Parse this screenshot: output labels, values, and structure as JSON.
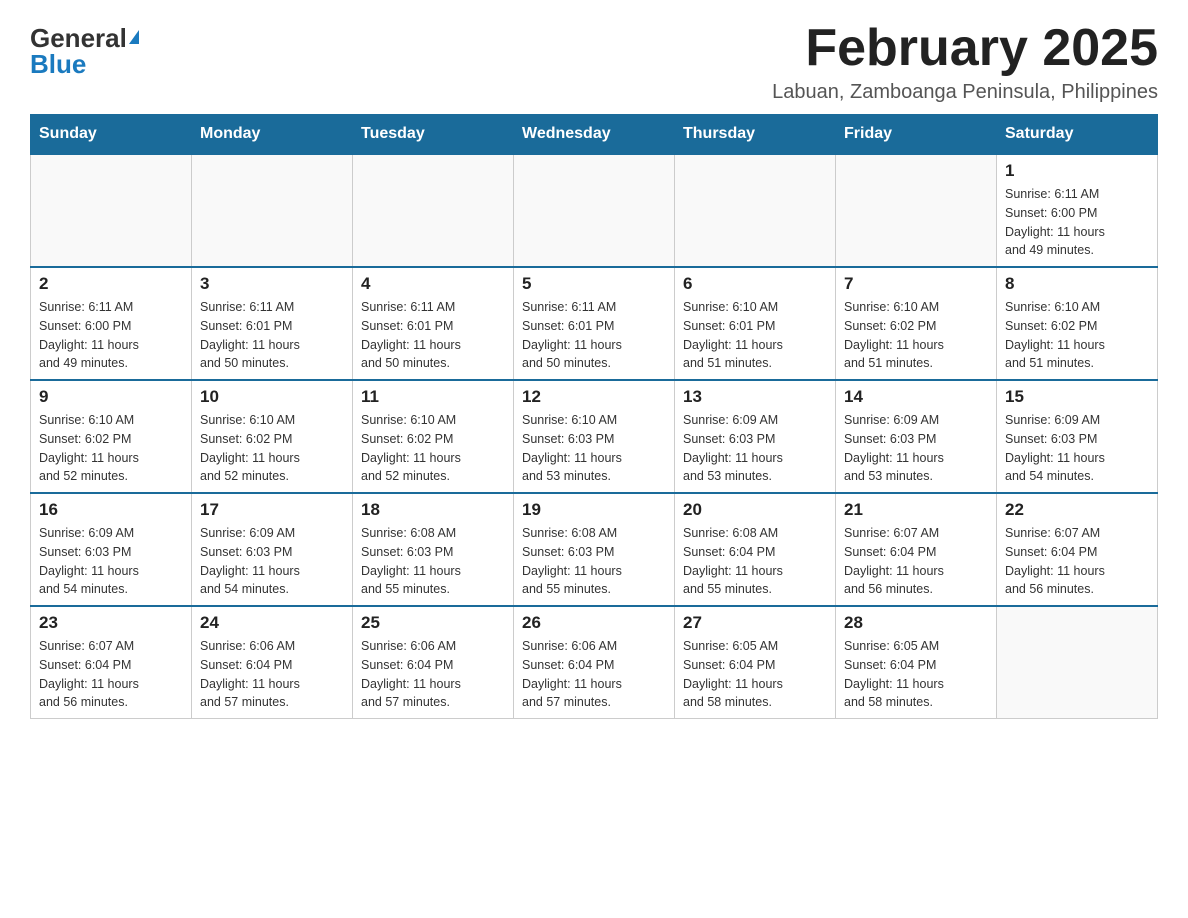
{
  "logo": {
    "general": "General",
    "blue": "Blue"
  },
  "title": {
    "month_year": "February 2025",
    "location": "Labuan, Zamboanga Peninsula, Philippines"
  },
  "weekdays": [
    "Sunday",
    "Monday",
    "Tuesday",
    "Wednesday",
    "Thursday",
    "Friday",
    "Saturday"
  ],
  "weeks": [
    [
      {
        "day": "",
        "info": ""
      },
      {
        "day": "",
        "info": ""
      },
      {
        "day": "",
        "info": ""
      },
      {
        "day": "",
        "info": ""
      },
      {
        "day": "",
        "info": ""
      },
      {
        "day": "",
        "info": ""
      },
      {
        "day": "1",
        "info": "Sunrise: 6:11 AM\nSunset: 6:00 PM\nDaylight: 11 hours\nand 49 minutes."
      }
    ],
    [
      {
        "day": "2",
        "info": "Sunrise: 6:11 AM\nSunset: 6:00 PM\nDaylight: 11 hours\nand 49 minutes."
      },
      {
        "day": "3",
        "info": "Sunrise: 6:11 AM\nSunset: 6:01 PM\nDaylight: 11 hours\nand 50 minutes."
      },
      {
        "day": "4",
        "info": "Sunrise: 6:11 AM\nSunset: 6:01 PM\nDaylight: 11 hours\nand 50 minutes."
      },
      {
        "day": "5",
        "info": "Sunrise: 6:11 AM\nSunset: 6:01 PM\nDaylight: 11 hours\nand 50 minutes."
      },
      {
        "day": "6",
        "info": "Sunrise: 6:10 AM\nSunset: 6:01 PM\nDaylight: 11 hours\nand 51 minutes."
      },
      {
        "day": "7",
        "info": "Sunrise: 6:10 AM\nSunset: 6:02 PM\nDaylight: 11 hours\nand 51 minutes."
      },
      {
        "day": "8",
        "info": "Sunrise: 6:10 AM\nSunset: 6:02 PM\nDaylight: 11 hours\nand 51 minutes."
      }
    ],
    [
      {
        "day": "9",
        "info": "Sunrise: 6:10 AM\nSunset: 6:02 PM\nDaylight: 11 hours\nand 52 minutes."
      },
      {
        "day": "10",
        "info": "Sunrise: 6:10 AM\nSunset: 6:02 PM\nDaylight: 11 hours\nand 52 minutes."
      },
      {
        "day": "11",
        "info": "Sunrise: 6:10 AM\nSunset: 6:02 PM\nDaylight: 11 hours\nand 52 minutes."
      },
      {
        "day": "12",
        "info": "Sunrise: 6:10 AM\nSunset: 6:03 PM\nDaylight: 11 hours\nand 53 minutes."
      },
      {
        "day": "13",
        "info": "Sunrise: 6:09 AM\nSunset: 6:03 PM\nDaylight: 11 hours\nand 53 minutes."
      },
      {
        "day": "14",
        "info": "Sunrise: 6:09 AM\nSunset: 6:03 PM\nDaylight: 11 hours\nand 53 minutes."
      },
      {
        "day": "15",
        "info": "Sunrise: 6:09 AM\nSunset: 6:03 PM\nDaylight: 11 hours\nand 54 minutes."
      }
    ],
    [
      {
        "day": "16",
        "info": "Sunrise: 6:09 AM\nSunset: 6:03 PM\nDaylight: 11 hours\nand 54 minutes."
      },
      {
        "day": "17",
        "info": "Sunrise: 6:09 AM\nSunset: 6:03 PM\nDaylight: 11 hours\nand 54 minutes."
      },
      {
        "day": "18",
        "info": "Sunrise: 6:08 AM\nSunset: 6:03 PM\nDaylight: 11 hours\nand 55 minutes."
      },
      {
        "day": "19",
        "info": "Sunrise: 6:08 AM\nSunset: 6:03 PM\nDaylight: 11 hours\nand 55 minutes."
      },
      {
        "day": "20",
        "info": "Sunrise: 6:08 AM\nSunset: 6:04 PM\nDaylight: 11 hours\nand 55 minutes."
      },
      {
        "day": "21",
        "info": "Sunrise: 6:07 AM\nSunset: 6:04 PM\nDaylight: 11 hours\nand 56 minutes."
      },
      {
        "day": "22",
        "info": "Sunrise: 6:07 AM\nSunset: 6:04 PM\nDaylight: 11 hours\nand 56 minutes."
      }
    ],
    [
      {
        "day": "23",
        "info": "Sunrise: 6:07 AM\nSunset: 6:04 PM\nDaylight: 11 hours\nand 56 minutes."
      },
      {
        "day": "24",
        "info": "Sunrise: 6:06 AM\nSunset: 6:04 PM\nDaylight: 11 hours\nand 57 minutes."
      },
      {
        "day": "25",
        "info": "Sunrise: 6:06 AM\nSunset: 6:04 PM\nDaylight: 11 hours\nand 57 minutes."
      },
      {
        "day": "26",
        "info": "Sunrise: 6:06 AM\nSunset: 6:04 PM\nDaylight: 11 hours\nand 57 minutes."
      },
      {
        "day": "27",
        "info": "Sunrise: 6:05 AM\nSunset: 6:04 PM\nDaylight: 11 hours\nand 58 minutes."
      },
      {
        "day": "28",
        "info": "Sunrise: 6:05 AM\nSunset: 6:04 PM\nDaylight: 11 hours\nand 58 minutes."
      },
      {
        "day": "",
        "info": ""
      }
    ]
  ]
}
